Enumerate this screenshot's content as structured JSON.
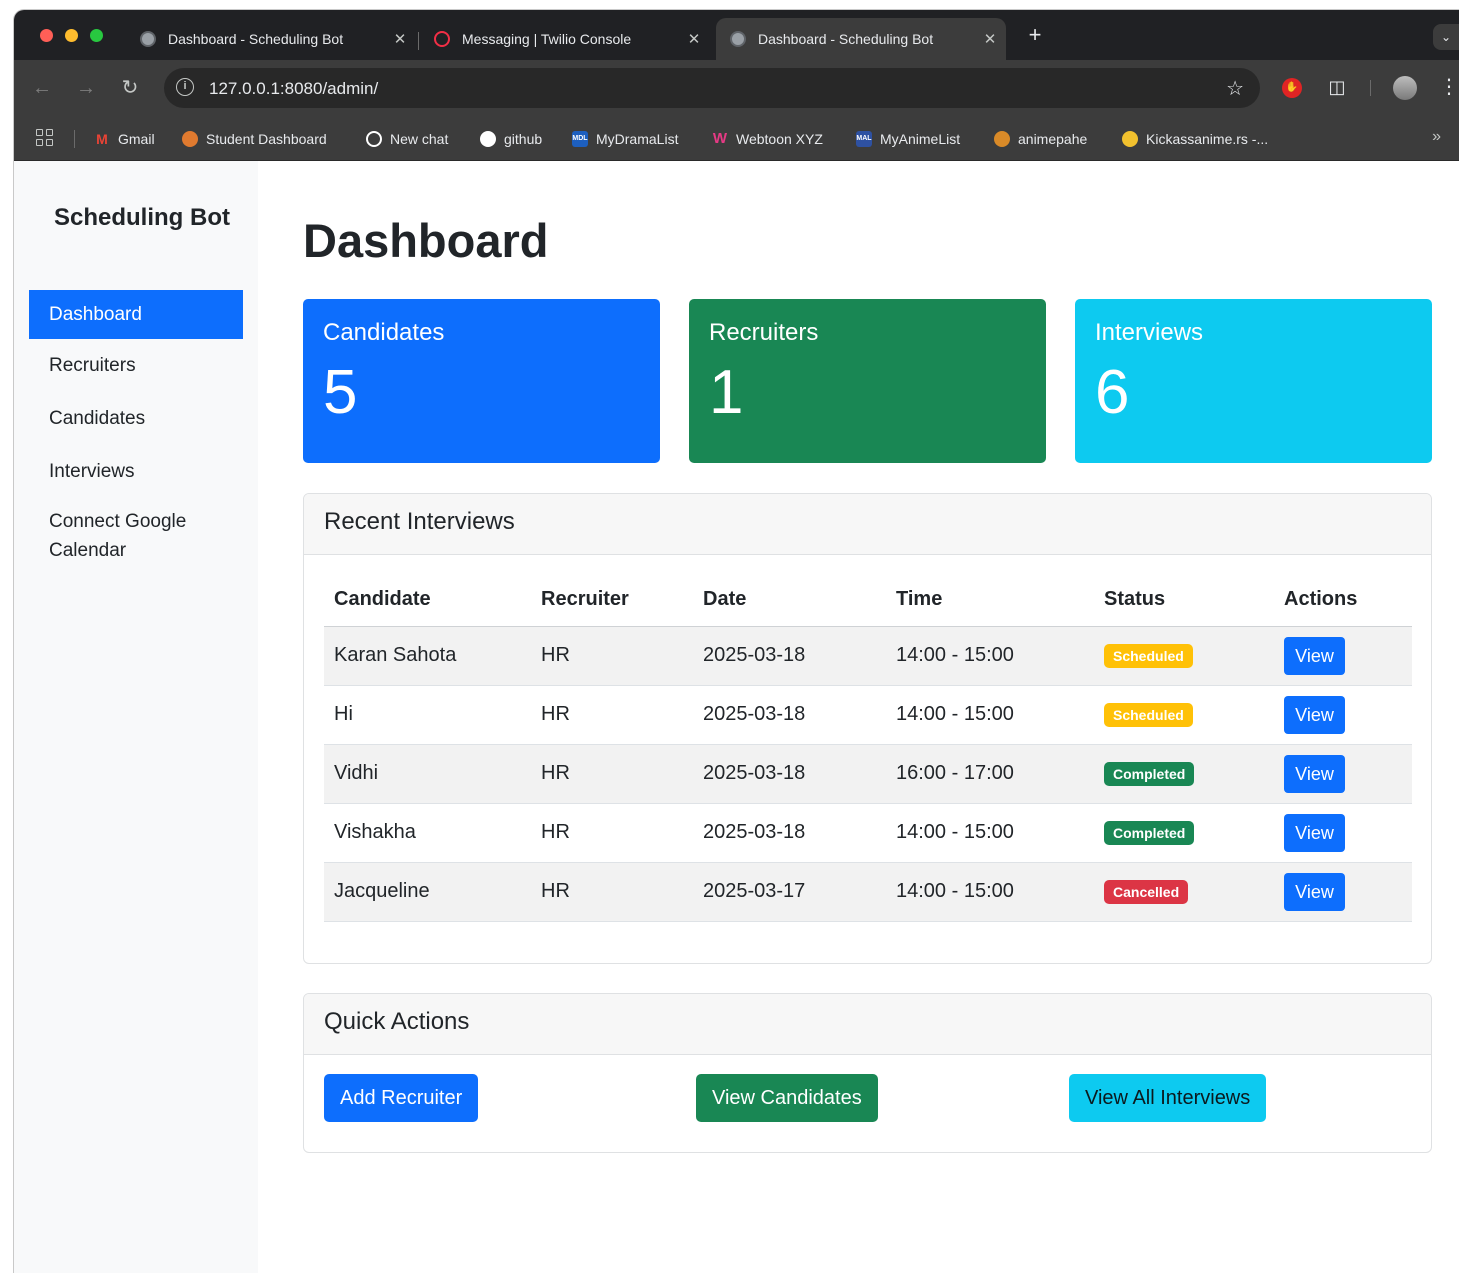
{
  "browser": {
    "tabs": [
      {
        "title": "Dashboard - Scheduling Bot",
        "active": false
      },
      {
        "title": "Messaging | Twilio Console",
        "active": false
      },
      {
        "title": "Dashboard - Scheduling Bot",
        "active": true
      }
    ],
    "close_glyph": "✕",
    "new_tab_glyph": "+",
    "url": "127.0.0.1:8080/admin/",
    "bookmarks": [
      {
        "label": "Gmail",
        "icon": "gmail-icon",
        "color": "#ea4335"
      },
      {
        "label": "Student Dashboard",
        "icon": "student-dashboard-icon",
        "color": "#e07a2f"
      },
      {
        "label": "New chat",
        "icon": "openai-icon",
        "color": "#ffffff"
      },
      {
        "label": "github",
        "icon": "github-icon",
        "color": "#ffffff"
      },
      {
        "label": "MyDramaList",
        "icon": "mydramalist-icon",
        "color": "#1d5fbf"
      },
      {
        "label": "Webtoon XYZ",
        "icon": "webtoon-icon",
        "color": "#e63a85"
      },
      {
        "label": "MyAnimeList",
        "icon": "myanimelist-icon",
        "color": "#2e51a2"
      },
      {
        "label": "animepahe",
        "icon": "animepahe-icon",
        "color": "#d98a28"
      },
      {
        "label": "Kickassanime.rs -...",
        "icon": "kickassanime-icon",
        "color": "#f2c12e"
      }
    ]
  },
  "sidebar": {
    "brand": "Scheduling Bot",
    "items": [
      {
        "label": "Dashboard",
        "active": true
      },
      {
        "label": "Recruiters",
        "active": false
      },
      {
        "label": "Candidates",
        "active": false
      },
      {
        "label": "Interviews",
        "active": false
      },
      {
        "label": "Connect Google Calendar",
        "active": false
      }
    ]
  },
  "main": {
    "title": "Dashboard",
    "stats": [
      {
        "label": "Candidates",
        "value": "5",
        "color": "#0d6efd"
      },
      {
        "label": "Recruiters",
        "value": "1",
        "color": "#198754"
      },
      {
        "label": "Interviews",
        "value": "6",
        "color": "#0dcaf0"
      }
    ],
    "recent": {
      "title": "Recent Interviews",
      "columns": [
        "Candidate",
        "Recruiter",
        "Date",
        "Time",
        "Status",
        "Actions"
      ],
      "rows": [
        {
          "candidate": "Karan Sahota",
          "recruiter": "HR",
          "date": "2025-03-18",
          "time": "14:00 - 15:00",
          "status": "Scheduled",
          "action": "View"
        },
        {
          "candidate": "Hi",
          "recruiter": "HR",
          "date": "2025-03-18",
          "time": "14:00 - 15:00",
          "status": "Scheduled",
          "action": "View"
        },
        {
          "candidate": "Vidhi",
          "recruiter": "HR",
          "date": "2025-03-18",
          "time": "16:00 - 17:00",
          "status": "Completed",
          "action": "View"
        },
        {
          "candidate": "Vishakha",
          "recruiter": "HR",
          "date": "2025-03-18",
          "time": "14:00 - 15:00",
          "status": "Completed",
          "action": "View"
        },
        {
          "candidate": "Jacqueline",
          "recruiter": "HR",
          "date": "2025-03-17",
          "time": "14:00 - 15:00",
          "status": "Cancelled",
          "action": "View"
        }
      ]
    },
    "quick": {
      "title": "Quick Actions",
      "add_recruiter": "Add Recruiter",
      "view_candidates": "View Candidates",
      "view_all_interviews": "View All Interviews"
    }
  }
}
